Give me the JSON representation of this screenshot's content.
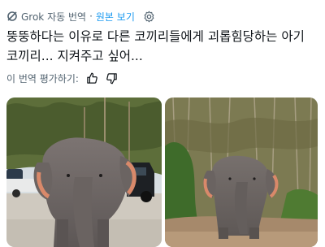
{
  "translation": {
    "source_label": "Grok 자동 번역",
    "separator": "·",
    "show_original": "원본 보기",
    "settings_icon": "gear-icon",
    "grok_icon": "grok-logo-icon"
  },
  "post": {
    "text": "뚱뚱하다는 이유로 다른 코끼리들에게 괴롭힘당하는 아기 코끼리... 지켜주고 싶어..."
  },
  "rating": {
    "prompt": "이 번역 평가하기:",
    "thumbs_up_icon": "thumbs-up-icon",
    "thumbs_down_icon": "thumbs-down-icon"
  },
  "media": {
    "photos": [
      "elephant-photo-parking-lot",
      "elephant-photo-forest"
    ]
  },
  "colors": {
    "link": "#1d9bf0",
    "muted": "#536471",
    "text": "#0f1419"
  }
}
